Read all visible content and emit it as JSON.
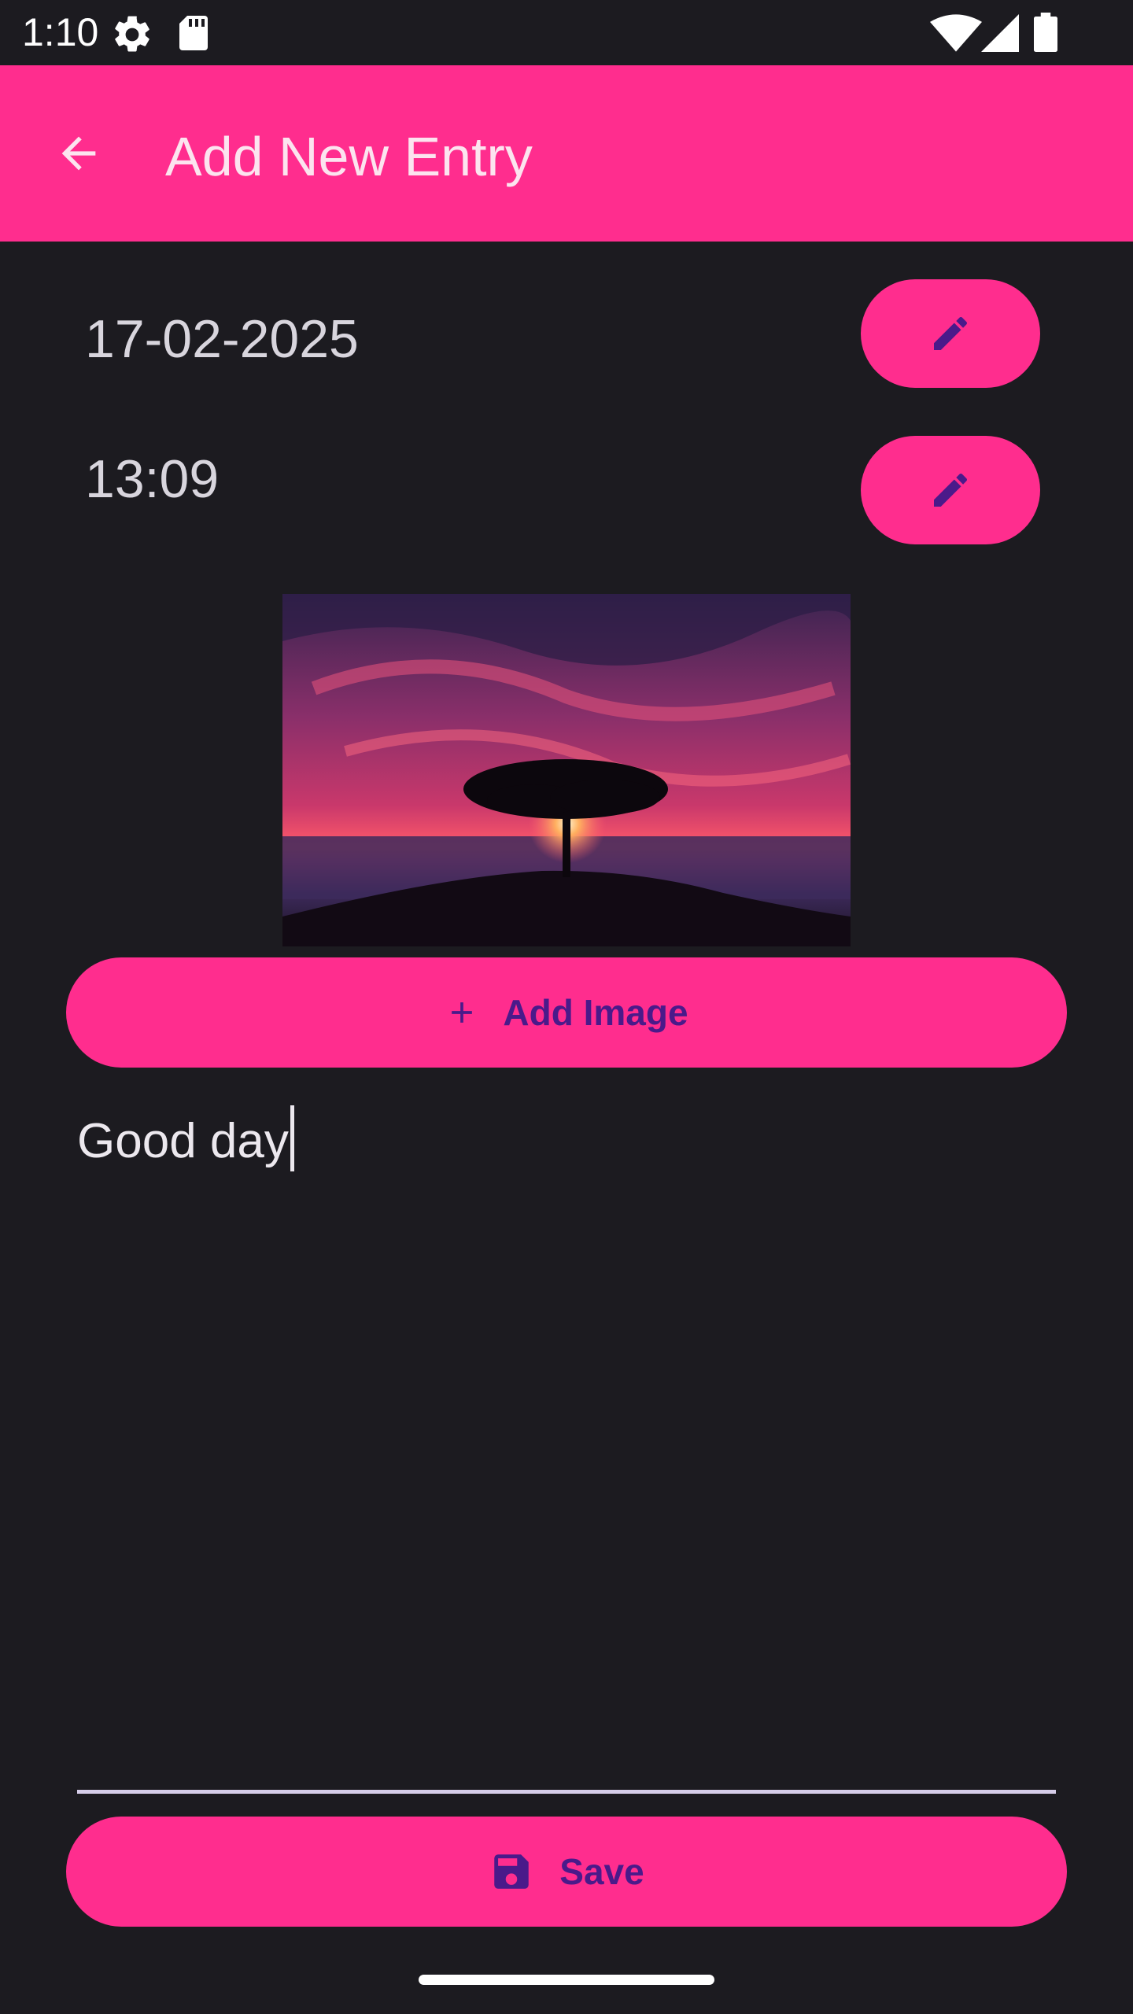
{
  "status_bar": {
    "time": "1:10",
    "icons": [
      "settings-gear-icon",
      "sd-card-icon",
      "wifi-icon",
      "cell-signal-icon",
      "battery-icon"
    ]
  },
  "app_bar": {
    "title": "Add New Entry",
    "back_icon": "arrow-back-icon"
  },
  "entry": {
    "date": "17-02-2025",
    "time": "13:09",
    "edit_icon": "pencil-icon",
    "image_description_icon": "photo",
    "add_image_label": "Add Image",
    "add_image_icon": "plus-icon",
    "text": "Good day",
    "save_label": "Save",
    "save_icon": "floppy-disk-icon"
  },
  "colors": {
    "accent": "#ff2d8e",
    "background": "#1c1b20",
    "button_text": "#4a1a8a",
    "underline": "#d6cde9"
  }
}
